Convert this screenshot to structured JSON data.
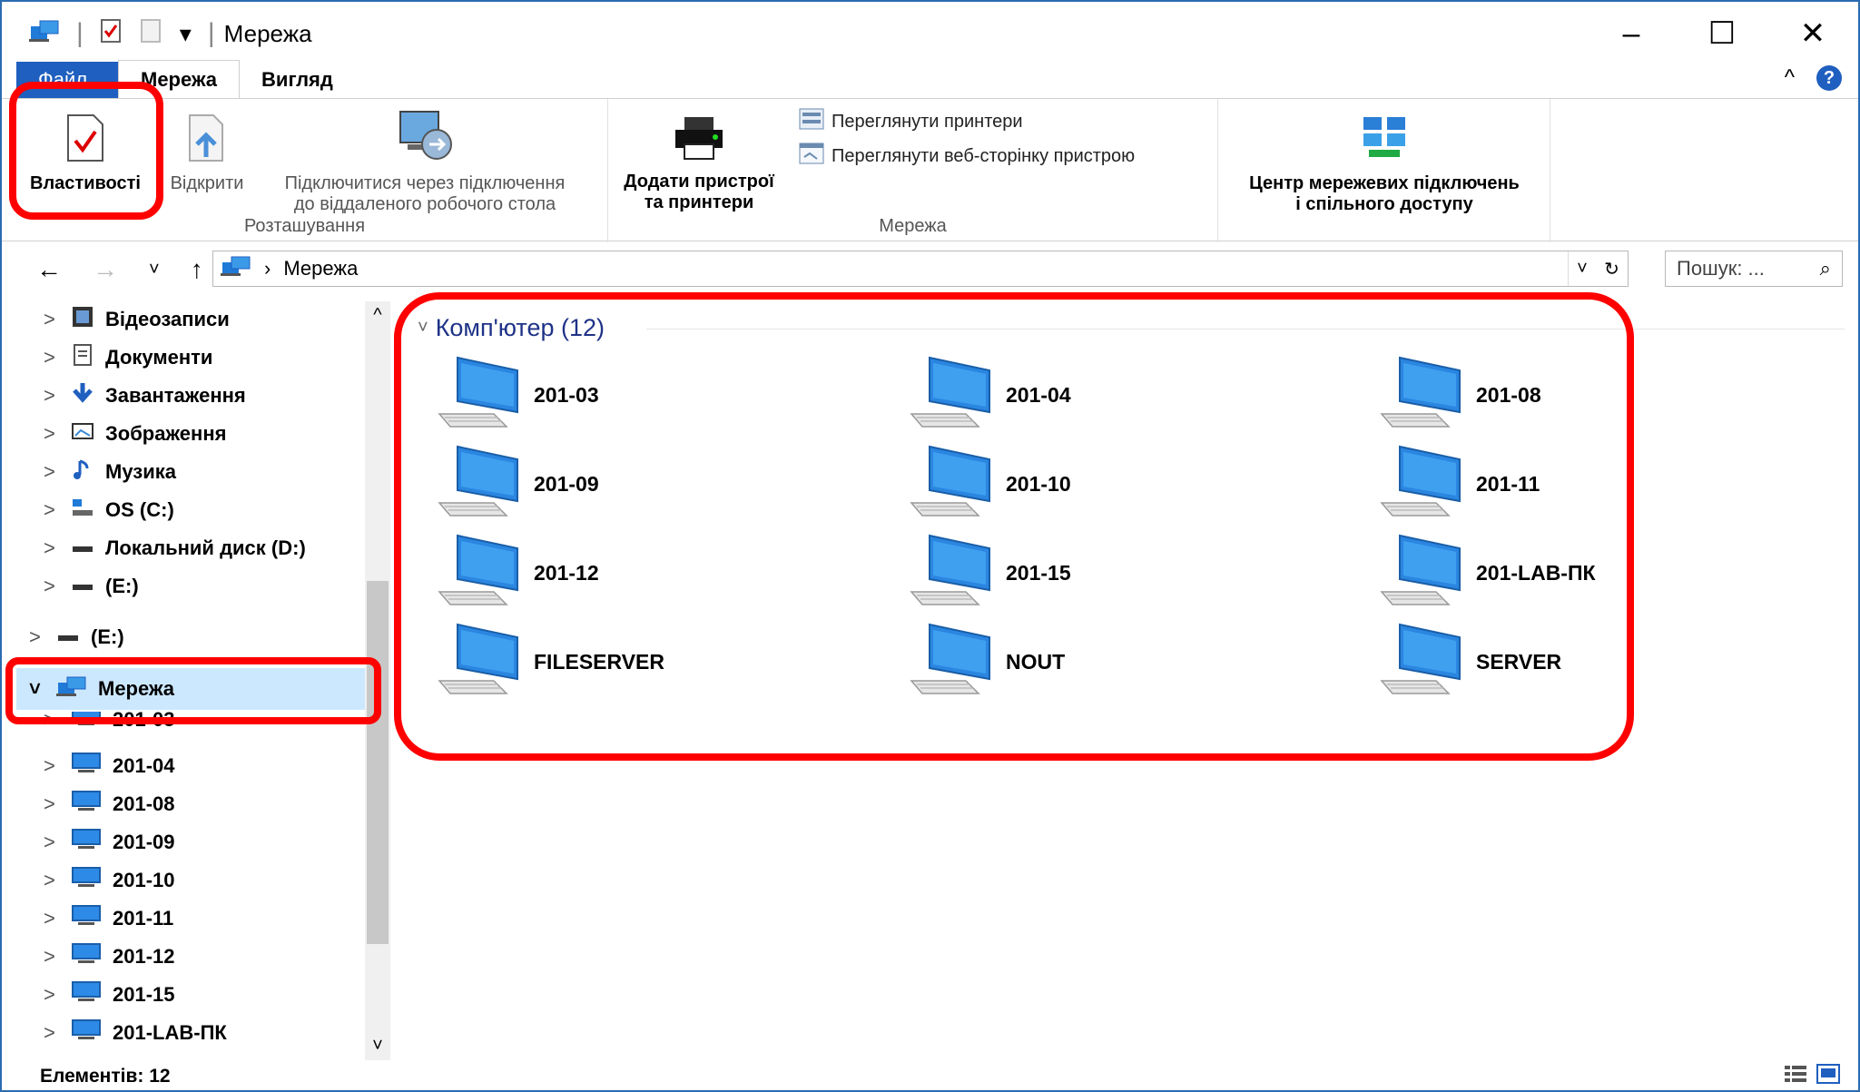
{
  "window": {
    "title": "Мережа",
    "controls": {
      "minimize": "–",
      "maximize": "☐",
      "close": "✕"
    }
  },
  "quick_access": {
    "separator": "|",
    "dropdown": "▾"
  },
  "tabs": [
    {
      "label": "Файл"
    },
    {
      "label": "Мережа"
    },
    {
      "label": "Вигляд"
    }
  ],
  "tab_extras": {
    "collapse": "^",
    "help": "?"
  },
  "ribbon": {
    "groups": [
      {
        "label": "Розташування",
        "buttons": [
          {
            "label": "Властивості"
          },
          {
            "label": "Відкрити"
          },
          {
            "label_line1": "Підключитися через підключення",
            "label_line2": "до віддаленого робочого стола"
          }
        ]
      },
      {
        "label": "Мережа",
        "buttons": [
          {
            "label_line1": "Додати пристрої",
            "label_line2": "та принтери"
          }
        ],
        "small_buttons": [
          {
            "label": "Переглянути принтери"
          },
          {
            "label": "Переглянути веб-сторінку пристрою"
          }
        ]
      },
      {
        "label": "",
        "buttons": [
          {
            "label_line1": "Центр мережевих підключень",
            "label_line2": "і спільного доступу"
          }
        ]
      }
    ]
  },
  "navigation": {
    "back": "←",
    "forward": "→",
    "recent": "˅",
    "up": "↑"
  },
  "address": {
    "separator": "›",
    "location": "Мережа",
    "dropdown": "˅",
    "refresh": "↻"
  },
  "search": {
    "placeholder": "Пошук: ...",
    "icon": "⌕"
  },
  "nav_pane": {
    "chevron_collapsed": ">",
    "chevron_expanded": "˅",
    "scroll_up": "^",
    "scroll_down": "˅",
    "items": [
      {
        "label": "Відеозаписи",
        "icon": "video-icon"
      },
      {
        "label": "Документи",
        "icon": "document-icon"
      },
      {
        "label": "Завантаження",
        "icon": "download-icon"
      },
      {
        "label": "Зображення",
        "icon": "pictures-icon"
      },
      {
        "label": "Музика",
        "icon": "music-icon"
      },
      {
        "label": "OS (C:)",
        "icon": "os-drive-icon"
      },
      {
        "label": "Локальний диск (D:)",
        "icon": "drive-icon"
      },
      {
        "label": "(E:)",
        "icon": "drive-icon"
      },
      {
        "label": "(E:)",
        "icon": "drive-icon"
      },
      {
        "label": "Мережа",
        "icon": "network-icon"
      },
      {
        "label": "201-03",
        "icon": "computer-icon"
      },
      {
        "label": "201-04",
        "icon": "computer-icon"
      },
      {
        "label": "201-08",
        "icon": "computer-icon"
      },
      {
        "label": "201-09",
        "icon": "computer-icon"
      },
      {
        "label": "201-10",
        "icon": "computer-icon"
      },
      {
        "label": "201-11",
        "icon": "computer-icon"
      },
      {
        "label": "201-12",
        "icon": "computer-icon"
      },
      {
        "label": "201-15",
        "icon": "computer-icon"
      },
      {
        "label": "201-LAB-ПК",
        "icon": "computer-icon"
      }
    ]
  },
  "content": {
    "group_chevron": "˅",
    "group_title": "Комп'ютер (12)",
    "computers": [
      {
        "name": "201-03"
      },
      {
        "name": "201-04"
      },
      {
        "name": "201-08"
      },
      {
        "name": "201-09"
      },
      {
        "name": "201-10"
      },
      {
        "name": "201-11"
      },
      {
        "name": "201-12"
      },
      {
        "name": "201-15"
      },
      {
        "name": "201-LAB-ПК"
      },
      {
        "name": "FILESERVER"
      },
      {
        "name": "NOUT"
      },
      {
        "name": "SERVER"
      }
    ]
  },
  "status": {
    "items_count": "Елементів: 12"
  },
  "colors": {
    "accent": "#1f5fbf",
    "highlight": "#ff0000",
    "selected": "#cce8ff",
    "group_title": "#1e3287"
  }
}
